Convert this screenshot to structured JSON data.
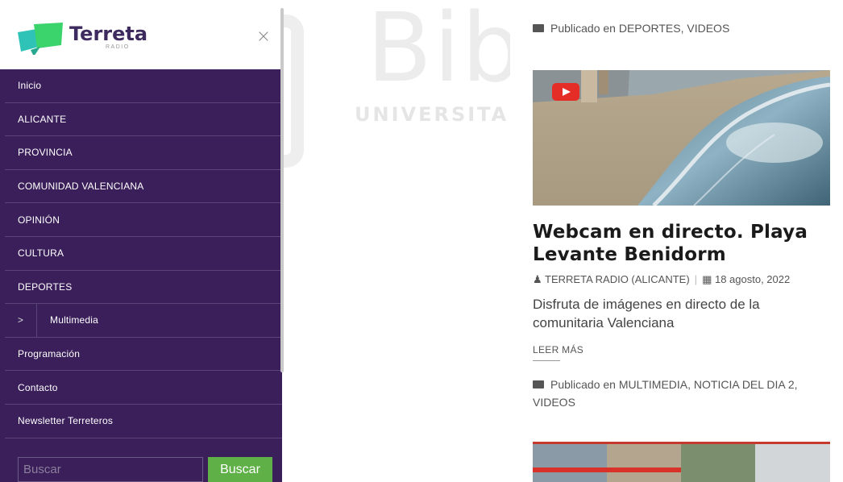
{
  "watermark": {
    "big": "Biblioteca",
    "small": "UNIVERSITAS Miguel Hernández"
  },
  "drawer": {
    "logo_text": "Terreta",
    "logo_sub": "RADIO",
    "close_glyph": "×",
    "menu": [
      {
        "label": "Inicio"
      },
      {
        "label": "ALICANTE"
      },
      {
        "label": "PROVINCIA"
      },
      {
        "label": "COMUNIDAD VALENCIANA"
      },
      {
        "label": "OPINIÓN"
      },
      {
        "label": "CULTURA"
      },
      {
        "label": "DEPORTES"
      },
      {
        "label": "Multimedia",
        "expand_glyph": ">"
      },
      {
        "label": "Programación"
      },
      {
        "label": "Contacto"
      },
      {
        "label": "Newsletter Terreteros"
      }
    ],
    "search": {
      "placeholder": "Buscar",
      "button_label": "Buscar"
    }
  },
  "content": {
    "top_category": "Publicado en DEPORTES, VIDEOS",
    "post": {
      "title": "Webcam en directo. Playa Levante Benidorm",
      "author": "TERRETA RADIO (ALICANTE)",
      "date": "18 agosto, 2022",
      "excerpt": "Disfruta de imágenes en directo de la comunitaria Valenciana",
      "read_more": "LEER MÁS",
      "category": "Publicado en MULTIMEDIA, NOTICIA DEL DIA 2, VIDEOS"
    }
  },
  "colors": {
    "drawer_bg": "#3a1f5a",
    "search_button": "#5fb046",
    "play_red": "#e52d27"
  },
  "icons": {
    "folder": "folder-icon",
    "user": "user-icon",
    "calendar": "calendar-icon",
    "play": "play-icon",
    "close": "close-icon",
    "chevron": "chevron-right-icon"
  }
}
